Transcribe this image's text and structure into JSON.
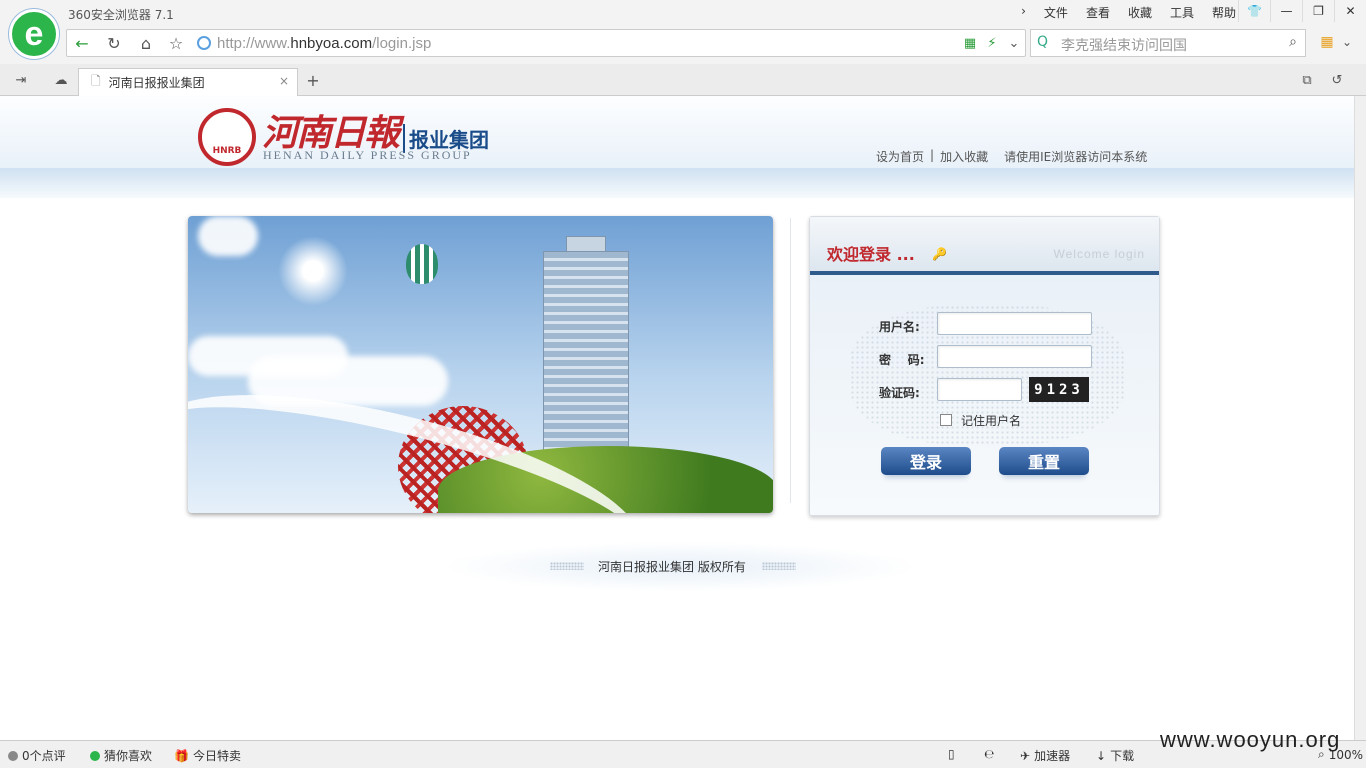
{
  "browser": {
    "name": "360安全浏览器 7.1",
    "menu": [
      "文件",
      "查看",
      "收藏",
      "工具",
      "帮助"
    ],
    "url_prefix": "http://www.",
    "url_domain": "hnbyoa.com",
    "url_path": "/login.jsp",
    "search_text": "李克强结束访问回国",
    "tab_title": "河南日报报业集团"
  },
  "site": {
    "logo_small": "HNRB",
    "title_cn": "河南日報",
    "subtitle": "报业集团",
    "title_en": "HENAN DAILY PRESS GROUP",
    "link_home": "设为首页",
    "sep": "|",
    "link_fav": "加入收藏",
    "link_ie": "请使用IE浏览器访问本系统"
  },
  "login": {
    "title": "欢迎登录 ...",
    "title_en": "Welcome  login",
    "username_label": "用户名:",
    "password_label": "密    码:",
    "captcha_label": "验证码:",
    "captcha_value": "9123",
    "remember_label": "记住用户名",
    "login_button": "登录",
    "reset_button": "重置"
  },
  "footer": {
    "copyright": "河南日报报业集团 版权所有"
  },
  "status": {
    "comments": "0个点评",
    "guess": "猜你喜欢",
    "deals": "今日特卖",
    "accelerator": "加速器",
    "download": "下载",
    "zoom": "100%"
  },
  "watermark": "www.wooyun.org"
}
